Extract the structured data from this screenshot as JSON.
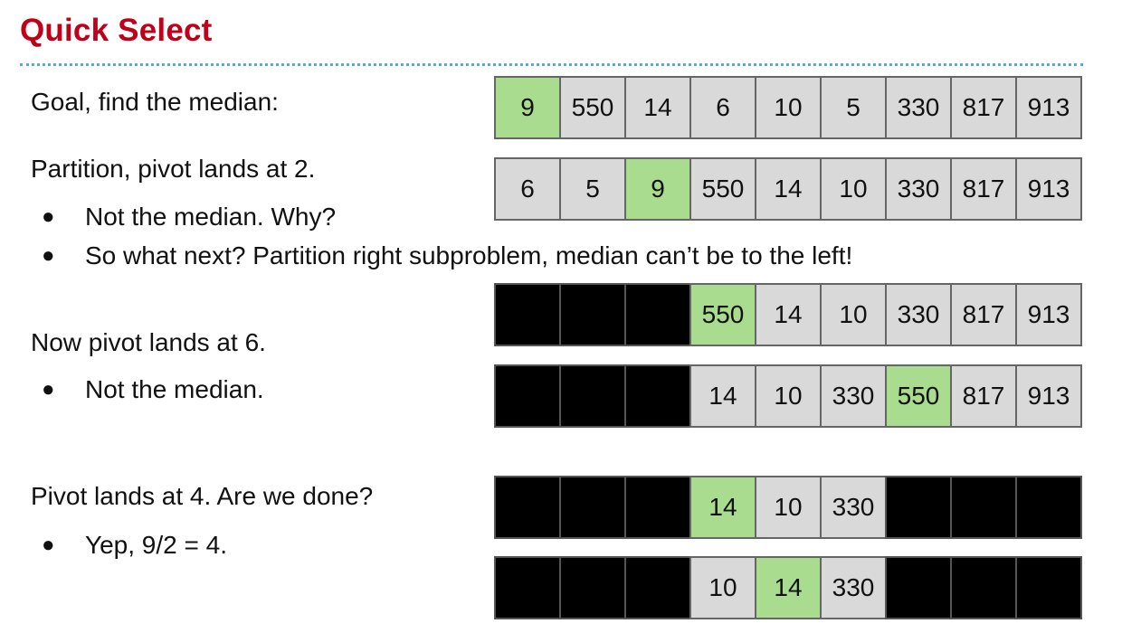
{
  "title": "Quick Select",
  "lines": {
    "goal": "Goal, find the median:",
    "partition": "Partition, pivot lands at 2.",
    "b1": "Not the median. Why?",
    "b2": "So what next?  Partition right subproblem, median can’t be to the left!",
    "now": "Now pivot lands at 6.",
    "b3": "Not the median.",
    "pivot4": "Pivot lands at 4. Are we done?",
    "b4": "Yep, 9/2 = 4."
  },
  "bullet_glyph": "●",
  "colors": {
    "title": "#c00018",
    "pivot": "#a9dc8f",
    "cell": "#d9d9d9",
    "masked": "#000000",
    "divider": "#5aa9d6"
  },
  "arrays": [
    {
      "cells": [
        "9",
        "550",
        "14",
        "6",
        "10",
        "5",
        "330",
        "817",
        "913"
      ],
      "pivot": 0,
      "masked": []
    },
    {
      "cells": [
        "6",
        "5",
        "9",
        "550",
        "14",
        "10",
        "330",
        "817",
        "913"
      ],
      "pivot": 2,
      "masked": []
    },
    {
      "cells": [
        "",
        "",
        "",
        "550",
        "14",
        "10",
        "330",
        "817",
        "913"
      ],
      "pivot": 3,
      "masked": [
        0,
        1,
        2
      ]
    },
    {
      "cells": [
        "",
        "",
        "",
        "14",
        "10",
        "330",
        "550",
        "817",
        "913"
      ],
      "pivot": 6,
      "masked": [
        0,
        1,
        2
      ]
    },
    {
      "cells": [
        "",
        "",
        "",
        "14",
        "10",
        "330",
        "",
        "",
        ""
      ],
      "pivot": 3,
      "masked": [
        0,
        1,
        2,
        6,
        7,
        8
      ]
    },
    {
      "cells": [
        "",
        "",
        "",
        "10",
        "14",
        "330",
        "",
        "",
        ""
      ],
      "pivot": 4,
      "masked": [
        0,
        1,
        2,
        6,
        7,
        8
      ]
    }
  ]
}
